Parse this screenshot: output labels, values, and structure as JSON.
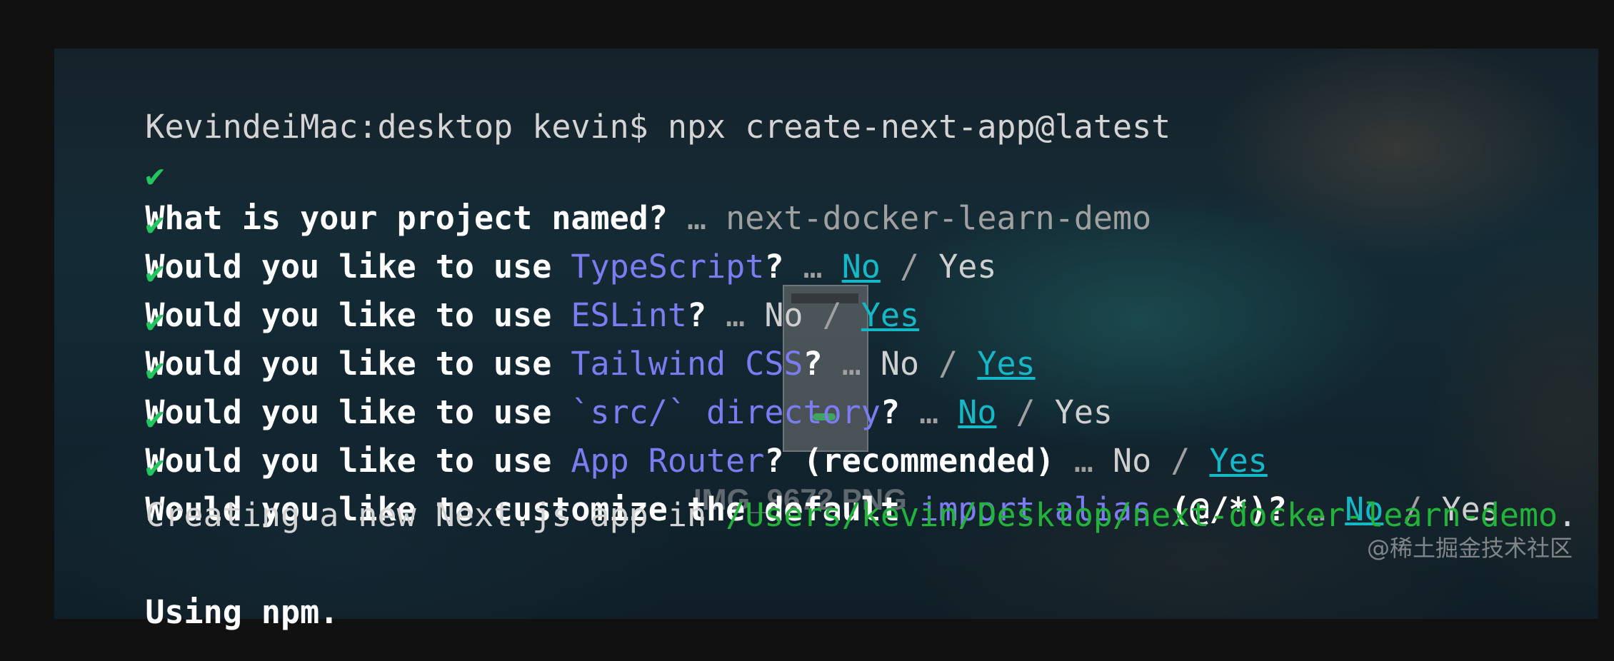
{
  "prompt": {
    "text": "KevindeiMac:desktop kevin$ npx create-next-app@latest"
  },
  "questions": [
    {
      "check": "✔",
      "prefix": "What is your project named?",
      "ellipsis": " … ",
      "answer": "next-docker-learn-demo"
    },
    {
      "check": "✔",
      "lead": "Would you like to use ",
      "highlight": "TypeScript",
      "tail": "?",
      "ellipsis": " … ",
      "no": "No",
      "sep": " / ",
      "yes": "Yes",
      "selected": "No"
    },
    {
      "check": "✔",
      "lead": "Would you like to use ",
      "highlight": "ESLint",
      "tail": "?",
      "ellipsis": " … ",
      "no": "No",
      "sep": " / ",
      "yes": "Yes",
      "selected": "Yes"
    },
    {
      "check": "✔",
      "lead": "Would you like to use ",
      "highlight": "Tailwind CSS",
      "tail": "?",
      "ellipsis": " … ",
      "no": "No",
      "sep": " / ",
      "yes": "Yes",
      "selected": "Yes"
    },
    {
      "check": "✔",
      "lead": "Would you like to use ",
      "highlight": "`src/` directory",
      "tail": "?",
      "ellipsis": " … ",
      "no": "No",
      "sep": " / ",
      "yes": "Yes",
      "selected": "No"
    },
    {
      "check": "✔",
      "lead": "Would you like to use ",
      "highlight": "App Router",
      "tail": "? (recommended)",
      "ellipsis": " … ",
      "no": "No",
      "sep": " / ",
      "yes": "Yes",
      "selected": "Yes"
    },
    {
      "check": "✔",
      "lead": "Would you like to customize the default ",
      "highlight": "import alias",
      "tail": " (@/*)?",
      "ellipsis": " … ",
      "no": "No",
      "sep": " / ",
      "yes": "Yes",
      "selected": "No"
    }
  ],
  "creating": {
    "prefix": "Creating a new Next.js app in ",
    "path": "/Users/kevin/Desktop/next-docker-learn-demo",
    "suffix": "."
  },
  "using": {
    "text": "Using npm."
  },
  "thumbnail": {
    "caption": "IMG_9672.PNG"
  },
  "watermark": {
    "text": "@稀土掘金技术社区"
  },
  "colors": {
    "check": "#22c55e",
    "highlight": "#7a7cf0",
    "selected": "#14b8c6",
    "path": "#22b33a"
  }
}
